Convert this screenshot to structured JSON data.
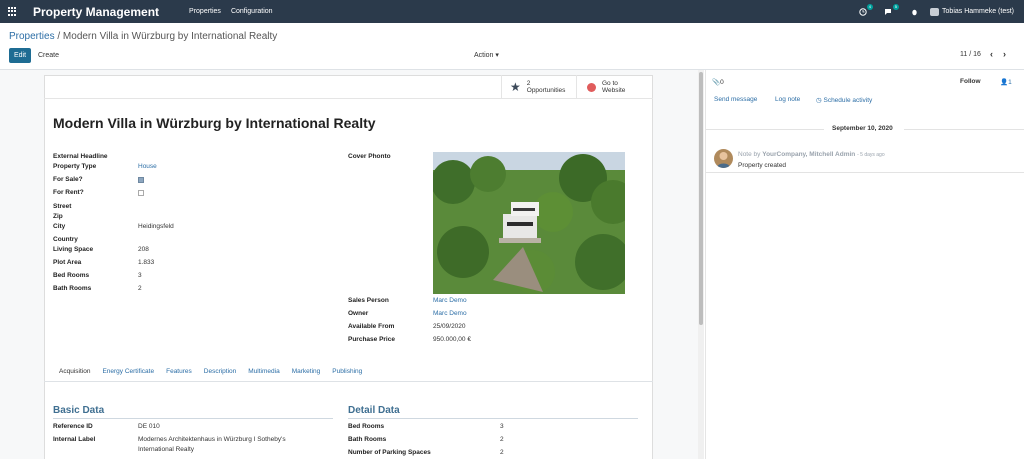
{
  "navbar": {
    "app_title": "Property Management",
    "menu": [
      "Properties",
      "Configuration"
    ],
    "activity_badge": "4",
    "messages_badge": "5",
    "user_name": "Tobias Hammeke (test)",
    "bg_color": "#2b3a4b",
    "badge_color": "#00a09d"
  },
  "breadcrumb": {
    "parent": "Properties",
    "separator": "/",
    "current": "Modern Villa in Würzburg by International Realty"
  },
  "toolbar": {
    "edit_label": "Edit",
    "create_label": "Create",
    "action_label": "Action",
    "pager_text": "11 / 16"
  },
  "button_box": {
    "opportunities_count": "2",
    "opportunities_label": "Opportunities",
    "go_to_label": "Go to",
    "website_label": "Website"
  },
  "record": {
    "title": "Modern Villa in Würzburg by International Realty",
    "left_fields": [
      {
        "label": "External Headline",
        "value": ""
      },
      {
        "label": "Property Type",
        "value": "House",
        "link": true
      },
      {
        "label": "For Sale?",
        "checkbox": true
      },
      {
        "label": "For Rent?",
        "checkbox": false
      },
      {
        "label": "Street",
        "value": ""
      },
      {
        "label": "Zip",
        "value": ""
      },
      {
        "label": "City",
        "value": "Heidingsfeld"
      },
      {
        "label": "Country",
        "value": ""
      },
      {
        "label": "Living Space",
        "value": "208"
      },
      {
        "label": "Plot Area",
        "value": "1.833"
      },
      {
        "label": "Bed Rooms",
        "value": "3"
      },
      {
        "label": "Bath Rooms",
        "value": "2"
      }
    ],
    "cover_photo_label": "Cover Phonto",
    "right_fields": [
      {
        "label": "Sales Person",
        "value": "Marc Demo",
        "link": true
      },
      {
        "label": "Owner",
        "value": "Marc Demo",
        "link": true
      },
      {
        "label": "Available From",
        "value": "25/09/2020"
      },
      {
        "label": "Purchase Price",
        "value": "950.000,00 €"
      }
    ]
  },
  "tabs": [
    "Acquisition",
    "Energy Certificate",
    "Features",
    "Description",
    "Multimedia",
    "Marketing",
    "Publishing"
  ],
  "basic_data": {
    "title": "Basic Data",
    "fields": [
      {
        "label": "Reference ID",
        "value": "DE 010"
      },
      {
        "label": "Internal Label",
        "value": "Modernes Architektenhaus in Würzburg I Sotheby's",
        "value2": "International Realty"
      }
    ]
  },
  "detail_data": {
    "title": "Detail Data",
    "fields": [
      {
        "label": "Bed Rooms",
        "value": "3"
      },
      {
        "label": "Bath Rooms",
        "value": "2"
      },
      {
        "label": "Number of Parking Spaces",
        "value": "2"
      }
    ]
  },
  "chatter": {
    "attachments": "0",
    "follow_label": "Follow",
    "followers": "1",
    "send_message": "Send message",
    "log_note": "Log note",
    "schedule_activity": "Schedule activity",
    "date_separator": "September 10, 2020",
    "note_prefix": "Note by",
    "note_author": "YourCompany, Mitchell Admin",
    "note_time": "- 5 days ago",
    "note_body": "Property created"
  }
}
